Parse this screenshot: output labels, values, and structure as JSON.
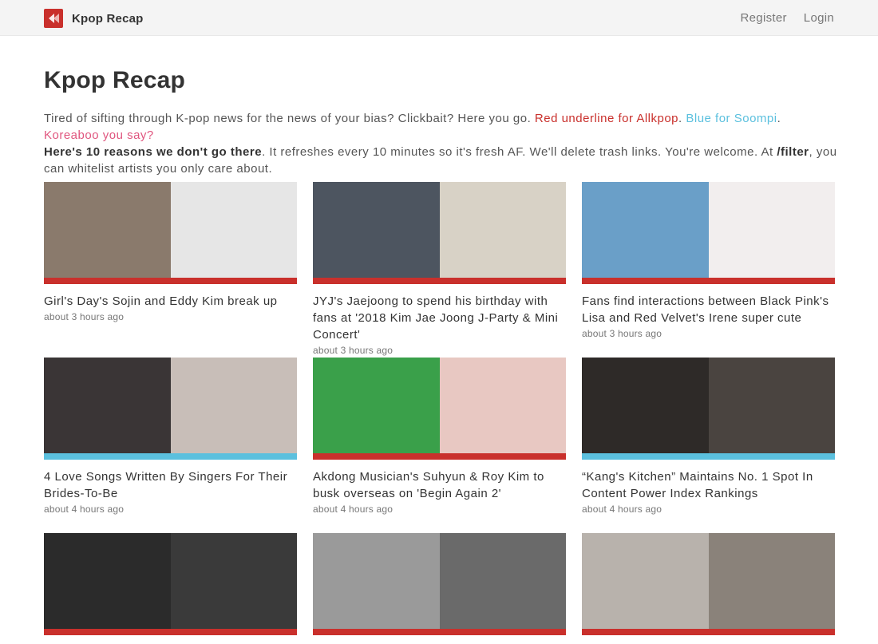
{
  "nav": {
    "brand": "Kpop Recap",
    "register": "Register",
    "login": "Login"
  },
  "page": {
    "title": "Kpop Recap"
  },
  "intro": {
    "part1": "Tired of sifting through K-pop news for the news of your bias? Clickbait? Here you go. ",
    "red_text": "Red underline for Allkpop",
    "dot1": ". ",
    "blue_text": "Blue for Soompi",
    "dot2": ". ",
    "pink_text": "Koreaboo you say?",
    "bold_reasons": "Here's 10 reasons we don't go there",
    "part2": ". It refreshes every 10 minutes so it's fresh AF. We'll delete trash links. You're welcome. At ",
    "bold_filter": "/filter",
    "part3": ", you can whitelist artists you only care about."
  },
  "colors": {
    "allkpop": "#c9302c",
    "soompi": "#5bc0de",
    "koreaboo": "#e0567f"
  },
  "articles": [
    {
      "title": "Girl's Day's Sojin and Eddy Kim break up",
      "time": "about 3 hours ago",
      "source": "allkpop",
      "image": [
        "#8a7a6c",
        "#e6e6e6"
      ]
    },
    {
      "title": "JYJ's Jaejoong to spend his birthday with fans at '2018 Kim Jae Joong J-Party & Mini Concert'",
      "time": "about 3 hours ago",
      "source": "allkpop",
      "image": [
        "#4d5560",
        "#d8d2c6"
      ]
    },
    {
      "title": "Fans find interactions between Black Pink's Lisa and Red Velvet's Irene super cute",
      "time": "about 3 hours ago",
      "source": "allkpop",
      "image": [
        "#6a9fc8",
        "#f2eeee"
      ]
    },
    {
      "title": "4 Love Songs Written By Singers For Their Brides-To-Be",
      "time": "about 4 hours ago",
      "source": "soompi",
      "image": [
        "#3a3536",
        "#c8beb8"
      ]
    },
    {
      "title": "Akdong Musician's Suhyun & Roy Kim to busk overseas on 'Begin Again 2'",
      "time": "about 4 hours ago",
      "source": "allkpop",
      "image": [
        "#3aa04a",
        "#e8c8c2"
      ]
    },
    {
      "title": "“Kang's Kitchen” Maintains No. 1 Spot In Content Power Index Rankings",
      "time": "about 4 hours ago",
      "source": "soompi",
      "image": [
        "#2e2a28",
        "#4a4440"
      ]
    },
    {
      "title": "",
      "time": "",
      "source": "allkpop",
      "image": [
        "#2b2b2b",
        "#3a3a3a"
      ]
    },
    {
      "title": "",
      "time": "",
      "source": "allkpop",
      "image": [
        "#9a9a9a",
        "#6a6a6a"
      ]
    },
    {
      "title": "",
      "time": "",
      "source": "allkpop",
      "image": [
        "#b8b2ac",
        "#8a827a"
      ]
    }
  ]
}
